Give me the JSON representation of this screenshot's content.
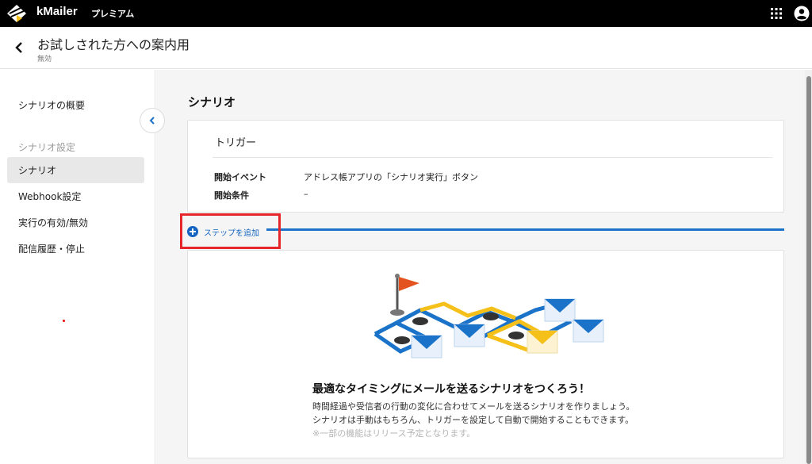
{
  "app": {
    "brand": "kMailer",
    "plan": "プレミアム"
  },
  "header": {
    "title": "お試しされた方への案内用",
    "status": "無効"
  },
  "sidebar": {
    "overview": "シナリオの概要",
    "section_label": "シナリオ設定",
    "items": [
      {
        "label": "シナリオ",
        "active": true
      },
      {
        "label": "Webhook設定",
        "active": false
      },
      {
        "label": "実行の有効/無効",
        "active": false
      },
      {
        "label": "配信履歴・停止",
        "active": false
      }
    ]
  },
  "main": {
    "title": "シナリオ",
    "trigger": {
      "title": "トリガー",
      "rows": [
        {
          "key": "開始イベント",
          "value": "アドレス帳アプリの「シナリオ実行」ボタン"
        },
        {
          "key": "開始条件",
          "value": "–"
        }
      ]
    },
    "add_step_label": "ステップを追加",
    "empty_state": {
      "heading": "最適なタイミングにメールを送るシナリオをつくろう！",
      "desc_line1": "時間経過や受信者の行動の変化に合わせてメールを送るシナリオを作りましょう。",
      "desc_line2": "シナリオは手動はもちろん、トリガーを設定して自動で開始することもできます。",
      "note": "※一部の機能はリリース予定となります。"
    }
  },
  "colors": {
    "accent": "#1565c0",
    "highlight": "#e5262b",
    "flag": "#e2531f",
    "path_yellow": "#f5c01a"
  }
}
